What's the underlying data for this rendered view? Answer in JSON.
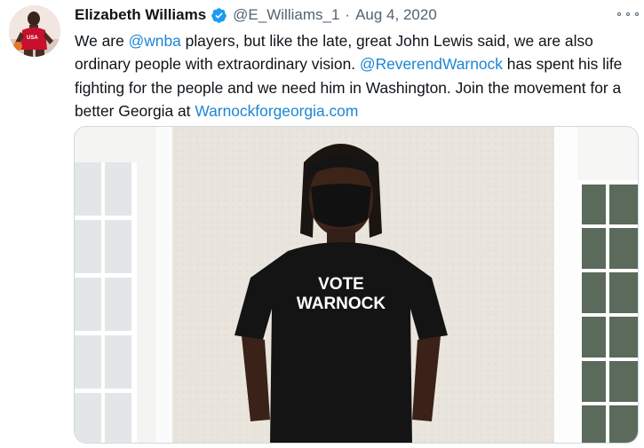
{
  "author": {
    "name": "Elizabeth Williams",
    "handle": "@E_Williams_1",
    "separator": "·",
    "date": "Aug 4, 2020",
    "verified": true
  },
  "tweet": {
    "t1": "We are ",
    "mention1": "@wnba",
    "t2": " players, but like the late, great John Lewis said, we are also ordinary people with extraordinary vision. ",
    "mention2": "@ReverendWarnock",
    "t3": " has spent his life fighting for the people and we need him in Washington. Join the movement for a better Georgia at ",
    "link": "Warnockforgeorgia.com"
  },
  "media": {
    "shirt_line1": "VOTE",
    "shirt_line2": "WARNOCK"
  },
  "colors": {
    "accent": "#1d9bf0",
    "link": "#1b86d6",
    "text": "#0f1419",
    "meta": "#536471"
  },
  "icons": {
    "verified": "verified-badge-icon",
    "more": "more-options-icon"
  }
}
